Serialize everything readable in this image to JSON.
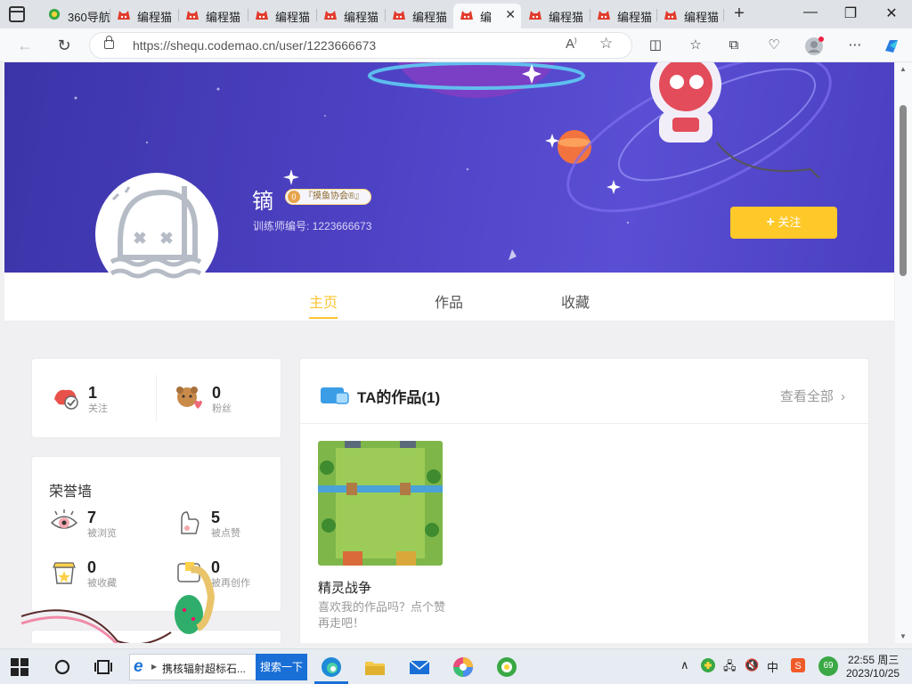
{
  "browser": {
    "tabs": [
      {
        "label": "360导航"
      },
      {
        "label": "编程猫"
      },
      {
        "label": "编程猫"
      },
      {
        "label": "编程猫"
      },
      {
        "label": "编程猫"
      },
      {
        "label": "编程猫"
      },
      {
        "label": "编",
        "active": true
      },
      {
        "label": "编程猫"
      },
      {
        "label": "编程猫"
      },
      {
        "label": "编程猫"
      }
    ],
    "url": "https://shequ.codemao.cn/user/1223666673"
  },
  "profile": {
    "username": "镝",
    "badge_level": "0",
    "badge_text": "『摸鱼协会®』",
    "trainer_id": "训练师编号: 1223666673",
    "follow_button": "关注"
  },
  "page_tabs": [
    {
      "label": "主页",
      "active": true
    },
    {
      "label": "作品"
    },
    {
      "label": "收藏"
    }
  ],
  "follow_stats": {
    "following_count": "1",
    "following_label": "关注",
    "fans_count": "0",
    "fans_label": "粉丝"
  },
  "honor_wall": {
    "title": "荣誉墙",
    "views_count": "7",
    "views_label": "被浏览",
    "likes_count": "5",
    "likes_label": "被点赞",
    "collected_count": "0",
    "collected_label": "被收藏",
    "remix_count": "0",
    "remix_label": "被再创作"
  },
  "works": {
    "title": "TA的作品(1)",
    "view_all": "查看全部",
    "items": [
      {
        "title": "精灵战争",
        "description": "喜欢我的作品吗？点个赞再走吧！"
      }
    ]
  },
  "taskbar": {
    "search_text": "携核辐射超标石...",
    "search_button": "搜索一下",
    "time": "22:55 周三",
    "date": "2023/10/25",
    "ime": "中",
    "badge_count": "69"
  },
  "colors": {
    "accent": "#fec433",
    "follow_button": "#ffc929",
    "banner": "#4f43c6"
  }
}
